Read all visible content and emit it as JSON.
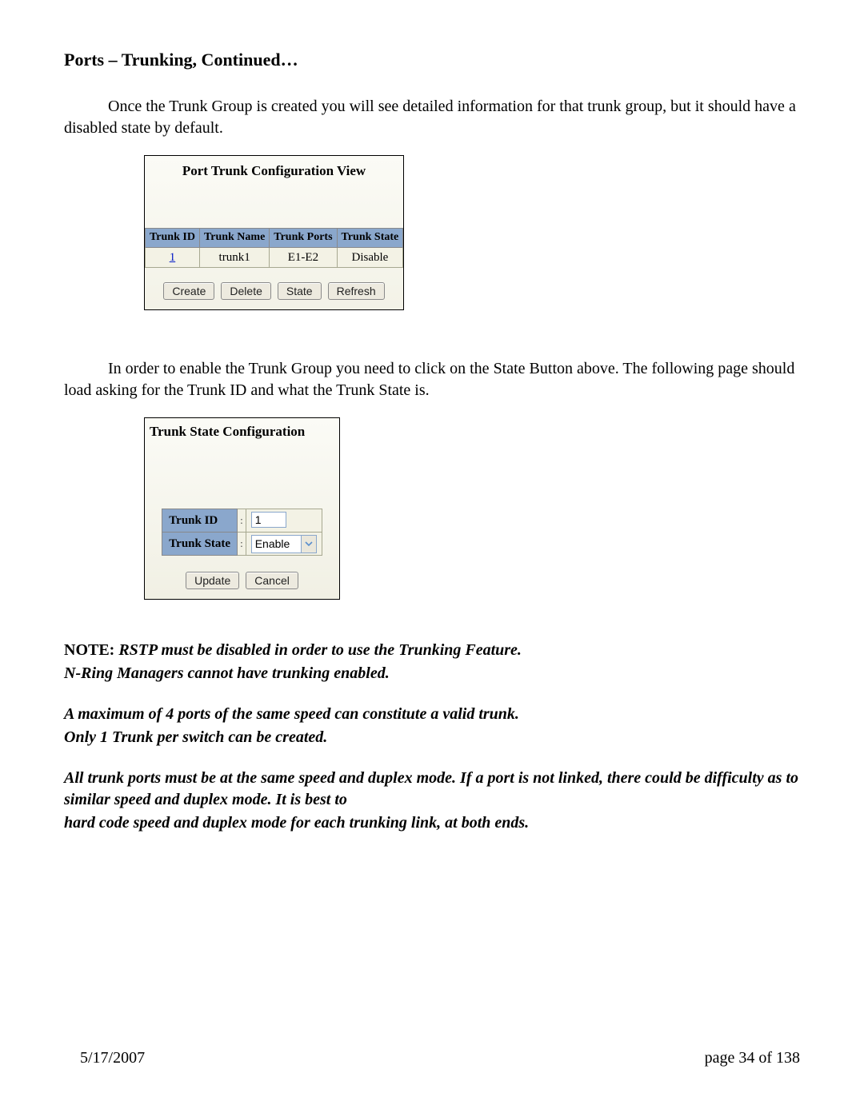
{
  "heading": "Ports – Trunking, Continued…",
  "para1": "Once the Trunk Group is created you will see detailed information for that trunk group, but it should have a disabled state by default.",
  "panel1": {
    "title": "Port Trunk Configuration View",
    "headers": [
      "Trunk ID",
      "Trunk Name",
      "Trunk Ports",
      "Trunk State"
    ],
    "row": {
      "id": "1",
      "name": "trunk1",
      "ports": "E1-E2",
      "state": "Disable"
    },
    "buttons": {
      "create": "Create",
      "delete": "Delete",
      "state": "State",
      "refresh": "Refresh"
    }
  },
  "para2": "In order to enable the Trunk Group you need to click on the State Button above.  The following page should load asking for the Trunk ID and what the Trunk State is.",
  "panel2": {
    "title": "Trunk State Configuration",
    "labels": {
      "id": "Trunk ID",
      "state": "Trunk State"
    },
    "values": {
      "id": "1",
      "state": "Enable"
    },
    "buttons": {
      "update": "Update",
      "cancel": "Cancel"
    }
  },
  "notes": {
    "label": "NOTE: ",
    "line1": "RSTP must be disabled in order to use the Trunking Feature.",
    "line2": "N-Ring Managers cannot have trunking enabled.",
    "line3": "A maximum of 4 ports of the same speed can constitute a valid trunk.",
    "line4": "Only 1 Trunk per switch can be created.",
    "line5": "All trunk ports must be at the same speed and duplex mode.  If a port is not linked, there could be difficulty as to similar speed and duplex mode.  It is best to",
    "line6": "hard code speed and duplex mode for each trunking link, at both ends."
  },
  "footer": {
    "date": "5/17/2007",
    "page": "page 34 of 138"
  }
}
